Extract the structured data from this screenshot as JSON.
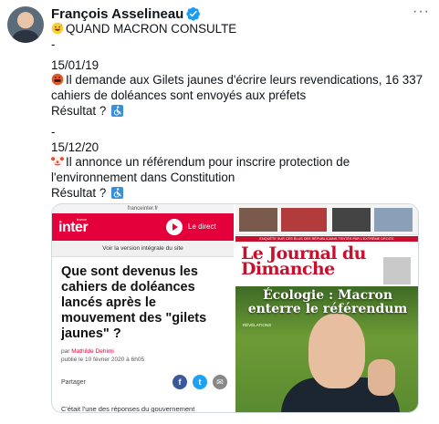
{
  "author": {
    "display_name": "François Asselineau",
    "verified": true
  },
  "tweet": {
    "lines": [
      "QUAND MACRON CONSULTE",
      "-",
      "15/01/19",
      "Il demande aux Gilets jaunes d'écrire leurs revendications, 16 337 cahiers de doléances sont envoyés aux préfets",
      "Résultat ?",
      "-",
      "15/12/20",
      "Il annonce un référendum pour inscrire protection de l'environnement dans Constitution",
      "Résultat ?",
      "-"
    ],
    "icons": {
      "intro": "grinning-sweat-emoji",
      "first_event": "swearing-face-emoji",
      "second_event": "clown-face-emoji",
      "result": "wheelchair-symbol-emoji"
    }
  },
  "media": {
    "left": {
      "url": "franceinter.fr",
      "brand": "inter",
      "brand_small": "france",
      "live_label": "Le direct",
      "full_version": "Voir la version intégrale du site",
      "headline": "Que sont devenus les cahiers de doléances lancés après le mouvement des \"gilets jaunes\" ?",
      "by": "par",
      "author": "Mathilde Dehimi",
      "published": "publié le 10 février 2020 à 6h05",
      "share_label": "Partager",
      "excerpt": "C'était l'une des réponses du gouvernement"
    },
    "right": {
      "masthead": "Le Journal du Dimanche",
      "strip": "ENQUÊTE SUR CES ÉLUS DES RÉPUBLICAINS TENTÉS PAR L'EXTRÊME DROITE",
      "headline": "Écologie : Macron enterre le référendum",
      "kicker": "RÉVÉLATIONS"
    }
  },
  "colors": {
    "inter_red": "#e4003a",
    "jdd_red": "#c8102e",
    "verified_blue": "#1d9bf0"
  }
}
